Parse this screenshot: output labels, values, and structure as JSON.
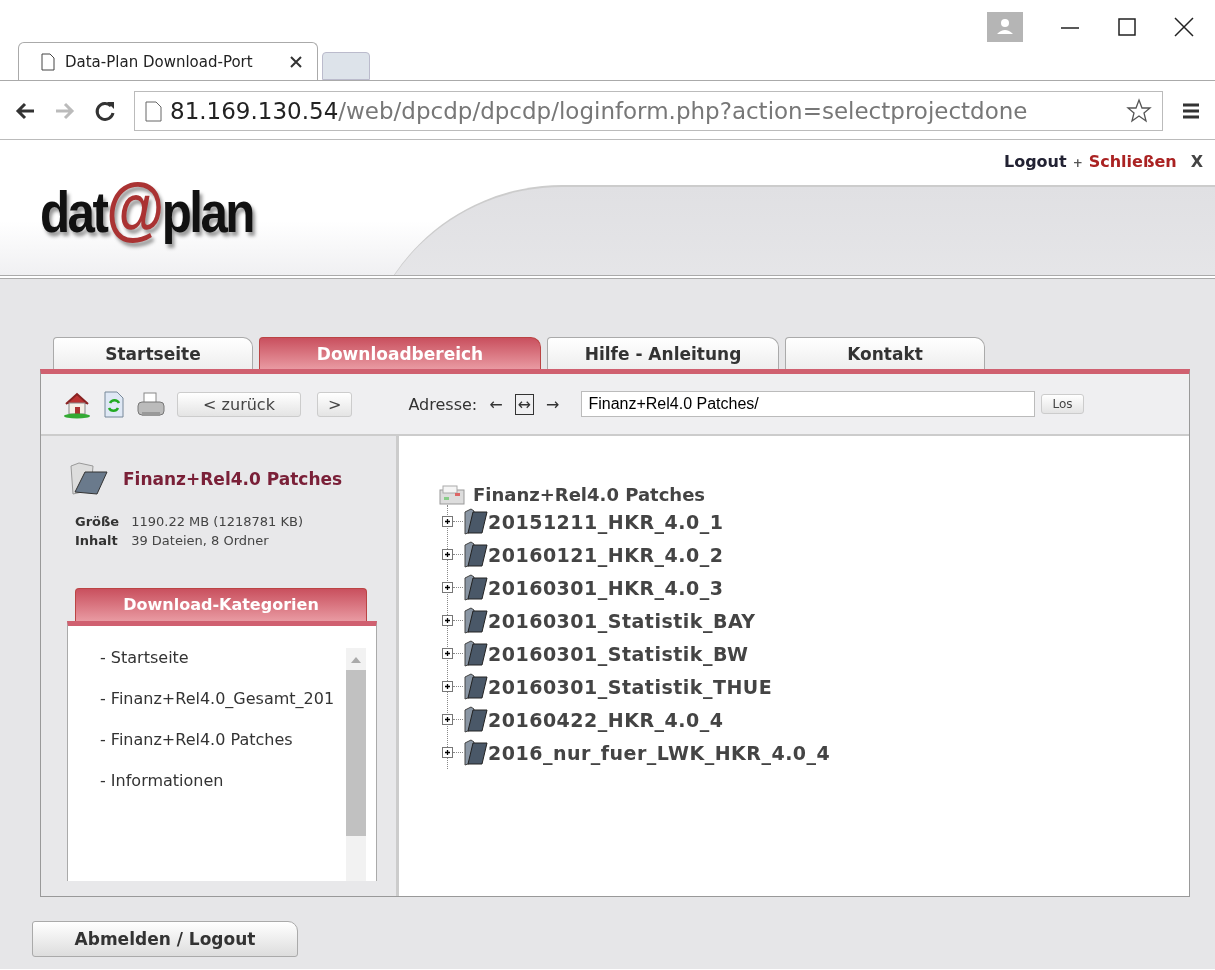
{
  "browser": {
    "tab_title": "Data-Plan Download-Port",
    "url_host": "81.169.130.54",
    "url_path": "/web/dpcdp/dpcdp/loginform.php?action=selectprojectdone"
  },
  "header": {
    "logo": {
      "before": "dat",
      "mark": "@",
      "after": "plan"
    },
    "logout_link": "Logout",
    "separator": "+",
    "close_link": "Schließen",
    "close_x": "X"
  },
  "tabs": [
    {
      "label": "Startseite",
      "selected": false
    },
    {
      "label": "Downloadbereich",
      "selected": true
    },
    {
      "label": "Hilfe - Anleitung",
      "selected": false
    },
    {
      "label": "Kontakt",
      "selected": false
    }
  ],
  "toolbar": {
    "back_button": "< zurück",
    "forward_button": ">",
    "address_label": "Adresse:",
    "nav_left": "←",
    "nav_both": "↔",
    "nav_right": "→",
    "address_value": "Finanz+Rel4.0 Patches/",
    "go_button": "Los"
  },
  "sidebar": {
    "folder_title": "Finanz+Rel4.0 Patches",
    "info": [
      {
        "label": "Größe",
        "value": "1190.22 MB (1218781 KB)"
      },
      {
        "label": "Inhalt",
        "value": "39 Dateien, 8 Ordner"
      }
    ],
    "categories_title": "Download-Kategorien",
    "categories": [
      "- Startseite",
      "- Finanz+Rel4.0_Gesamt_201",
      "- Finanz+Rel4.0 Patches",
      "- Informationen"
    ]
  },
  "tree": {
    "label": "Finanz+Rel4.0 Patches",
    "children": [
      {
        "label": "20151211_HKR_4.0_1",
        "expanded": false
      },
      {
        "label": "20160121_HKR_4.0_2",
        "expanded": false
      },
      {
        "label": "20160301_HKR_4.0_3",
        "expanded": false
      },
      {
        "label": "20160301_Statistik_BAY",
        "expanded": false
      },
      {
        "label": "20160301_Statistik_BW",
        "expanded": false
      },
      {
        "label": "20160301_Statistik_THUE",
        "expanded": false
      },
      {
        "label": "20160422_HKR_4.0_4",
        "expanded": false
      },
      {
        "label": "2016_nur_fuer_LWK_HKR_4.0_4",
        "expanded": false
      }
    ]
  },
  "logout_button": "Abmelden / Logout"
}
